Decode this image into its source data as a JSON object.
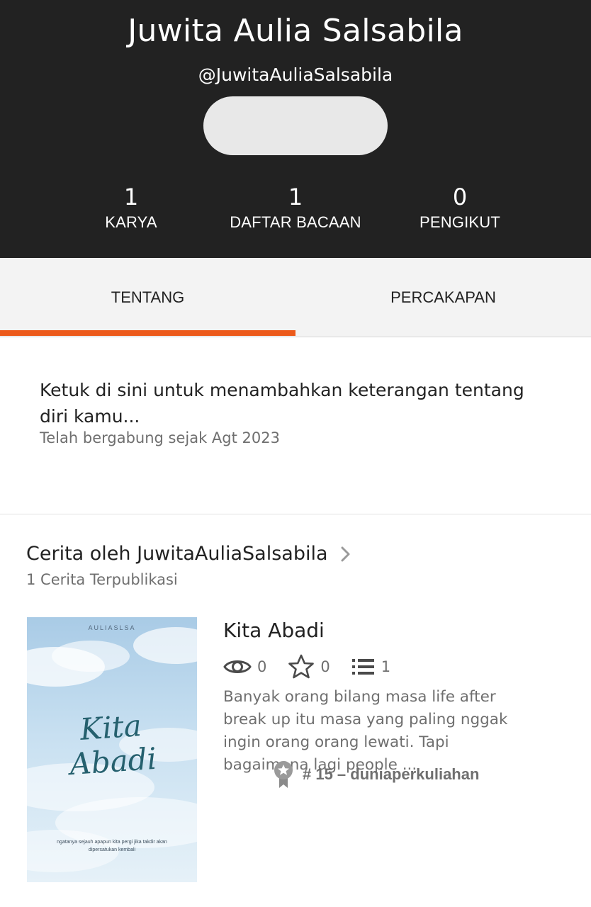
{
  "profile": {
    "display_name": "Juwita Aulia Salsabila",
    "username": "@JuwitaAuliaSalsabila"
  },
  "stats": {
    "works": {
      "value": "1",
      "label": "KARYA"
    },
    "reading_lists": {
      "value": "1",
      "label": "DAFTAR BACAAN"
    },
    "followers": {
      "value": "0",
      "label": "PENGIKUT"
    }
  },
  "tabs": {
    "about": "TENTANG",
    "conversations": "PERCAKAPAN",
    "active": "about"
  },
  "about": {
    "prompt": "Ketuk di sini untuk menambahkan keterangan tentang diri kamu...",
    "joined": "Telah bergabung sejak Agt 2023"
  },
  "stories_section": {
    "title": "Cerita oleh JuwitaAuliaSalsabila",
    "count_text": "1 Cerita Terpublikasi"
  },
  "story": {
    "title": "Kita Abadi",
    "reads": "0",
    "votes": "0",
    "parts": "1",
    "description": "Banyak orang bilang masa life after break up itu masa yang paling nggak ingin orang orang lewati. Tapi bagaimana lagi people ...",
    "ranking": "# 15 – duniaperkuliahan",
    "cover": {
      "author": "AULIASLSA",
      "title_line1": "Kita",
      "title_line2": "Abadi",
      "tagline": "ngatanya sejauh apapun kita pergi jika takdir akan dipersatukan kembali"
    }
  },
  "colors": {
    "header_bg": "#222222",
    "accent": "#ec5a1b",
    "tab_bg": "#f3f3f3",
    "muted_text": "#6f6f6f"
  },
  "icons": [
    "chevron-right-icon",
    "eye-icon",
    "star-icon",
    "list-icon",
    "ribbon-icon"
  ]
}
